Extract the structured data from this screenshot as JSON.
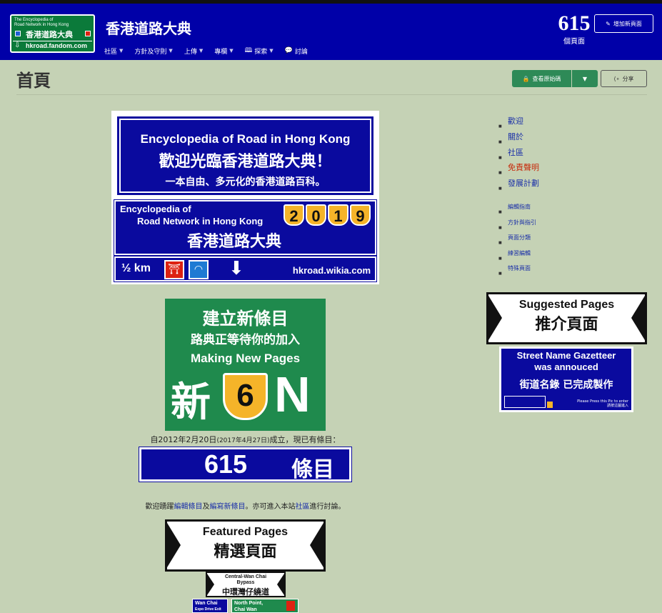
{
  "logo": {
    "line1": "The Encyclopedia of",
    "line2": "Road Network in Hong Kong",
    "zh": "香港道路大典",
    "url": "hkroad.fandom.com"
  },
  "header": {
    "site_name": "香港道路大典",
    "nav": [
      {
        "label": "社區",
        "icon": ""
      },
      {
        "label": "方針及守則",
        "icon": ""
      },
      {
        "label": "上傳",
        "icon": ""
      },
      {
        "label": "專欄",
        "icon": ""
      },
      {
        "label": "探索",
        "icon": "book-icon"
      },
      {
        "label": "討論",
        "icon": "chat-icon"
      }
    ],
    "page_count": "615",
    "page_count_label": "個頁面",
    "add_page_label": "增加新頁面"
  },
  "page": {
    "title": "首頁",
    "edit_label": "查看原始碼",
    "share_label": "分享"
  },
  "banner": {
    "en_title": "Encyclopedia of Road in Hong Kong",
    "zh_welcome": "歡迎光臨香港道路大典！",
    "zh_sub": "一本自由、多元化的香港道路百科。",
    "en_line1": "Encyclopedia of",
    "en_line2": "Road Network in Hong Kong",
    "zh_name": "香港道路大典",
    "year_digits": [
      "2",
      "0",
      "1",
      "9"
    ],
    "distance": "½ km",
    "url": "hkroad.wikia.com"
  },
  "new_pages_sign": {
    "zh1": "建立新條目",
    "zh2": "路典正等待你的加入",
    "en": "Making New Pages",
    "xin": "新",
    "route": "6",
    "dir": "N"
  },
  "since_text_a": "自2012年2月20日",
  "since_text_small": "(2017年4月27日)",
  "since_text_b": "成立，現已有條目：",
  "count_bar": {
    "number": "615",
    "word": "條目"
  },
  "welcome": {
    "prefix": "歡迎踴躍",
    "link1": "編輯條目",
    "mid1": "及",
    "link2": "編寫新條目",
    "mid2": "。亦可進入本站",
    "link3": "社區",
    "suffix": "進行討論。"
  },
  "featured": {
    "en": "Featured Pages",
    "zh": "精選頁面"
  },
  "bypass_sign": {
    "en1": "Central-Wan Chai",
    "en2": "Bypass",
    "zh": "中環灣仔繞道"
  },
  "exits": {
    "e1_line1": "Wan Chai",
    "e1_line2": "Expo Drive Exit",
    "e2_line1": "North Point,",
    "e2_line2": "Chai Wan"
  },
  "sidebar": {
    "primary": [
      {
        "label": "歡迎",
        "color": "#1a2fa8"
      },
      {
        "label": "關於",
        "color": "#1a2fa8"
      },
      {
        "label": "社區",
        "color": "#1a2fa8"
      },
      {
        "label": "免責聲明",
        "color": "#c62a0b"
      },
      {
        "label": "發展計劃",
        "color": "#1a2fa8"
      }
    ],
    "secondary": [
      {
        "label": "編輯指南"
      },
      {
        "label": "方針與指引"
      },
      {
        "label": "頁面分類"
      },
      {
        "label": "練習編輯"
      },
      {
        "label": "特殊頁面"
      }
    ]
  },
  "suggested": {
    "en": "Suggested Pages",
    "zh": "推介頁面"
  },
  "gazetteer": {
    "en1": "Street Name Gazetteer",
    "en2": "was annouced",
    "zh": "街道名錄 已完成製作",
    "press_en": "Please Press this Pic to enter",
    "press_zh": "請按這圖進入"
  },
  "colors": {
    "header_bg": "#0000a8",
    "page_bg": "#c5d2b5",
    "sign_blue": "#0a0a9e",
    "sign_green": "#1f8a4d",
    "shield_yellow": "#f5b429",
    "accent_green": "#2e8a57"
  }
}
